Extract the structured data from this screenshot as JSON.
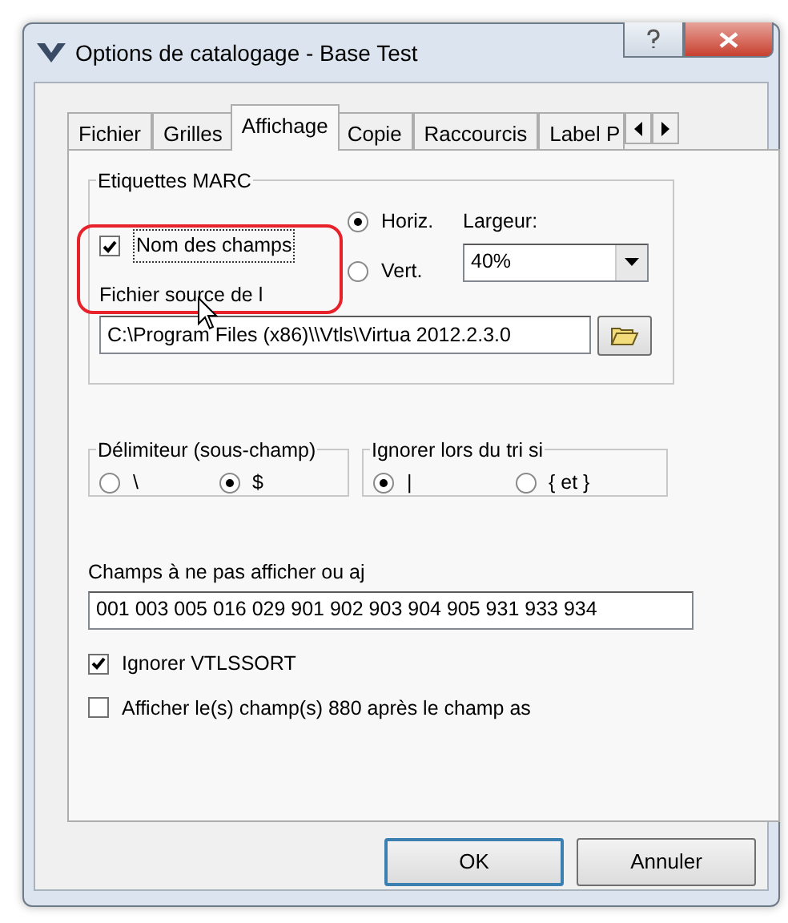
{
  "window": {
    "title": "Options de catalogage - Base Test"
  },
  "tabs": [
    {
      "label": "Fichier",
      "selected": false
    },
    {
      "label": "Grilles",
      "selected": false
    },
    {
      "label": "Affichage",
      "selected": true
    },
    {
      "label": "Copie",
      "selected": false
    },
    {
      "label": "Raccourcis",
      "selected": false
    },
    {
      "label": "Label P",
      "selected": false
    }
  ],
  "marc_group": {
    "title": "Etiquettes MARC",
    "field_names": {
      "label": "Nom des champs",
      "checked": true
    },
    "orientation": [
      {
        "label": "Horiz.",
        "selected": true
      },
      {
        "label": "Vert.",
        "selected": false
      }
    ],
    "width": {
      "label": "Largeur:",
      "value": "40%"
    },
    "source_file": {
      "label": "Fichier source de l",
      "value": "C:\\Program Files (x86)\\\\Vtls\\Virtua 2012.2.3.0"
    }
  },
  "delimiter_group": {
    "title": "Délimiteur (sous-champ)",
    "options": [
      {
        "label": "\\",
        "selected": false
      },
      {
        "label": "$",
        "selected": true
      }
    ]
  },
  "sort_group": {
    "title": "Ignorer lors du tri si",
    "options": [
      {
        "label": "|",
        "selected": true
      },
      {
        "label": "{ et }",
        "selected": false
      }
    ]
  },
  "hidden_fields": {
    "label": "Champs à ne pas afficher ou aj",
    "value": "001 003 005 016 029 901 902 903 904 905 931 933 934"
  },
  "checkboxes": [
    {
      "label": "Ignorer VTLSSORT",
      "checked": true
    },
    {
      "label": "Afficher le(s) champ(s) 880 après le champ as",
      "checked": false
    }
  ],
  "buttons": [
    {
      "label": "OK",
      "default": true
    },
    {
      "label": "Annuler",
      "default": false
    }
  ]
}
